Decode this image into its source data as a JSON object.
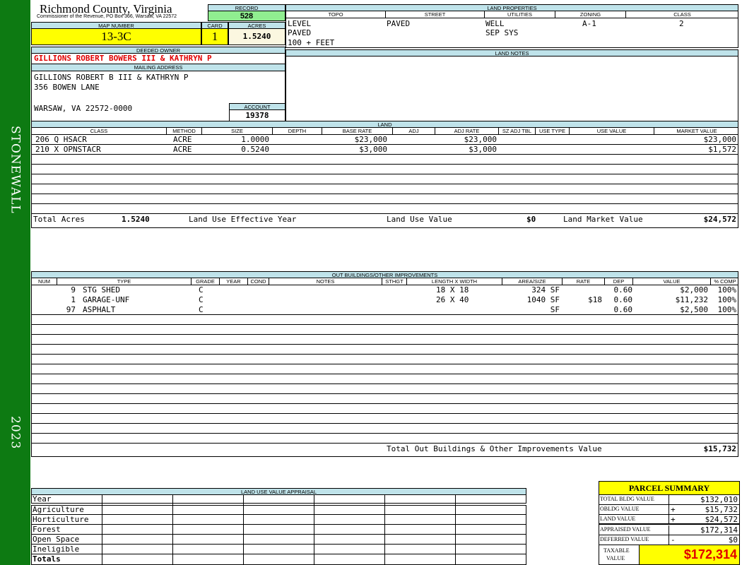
{
  "sidebar": {
    "district": "STONEWALL",
    "year": "2023"
  },
  "header": {
    "county": "Richmond County, Virginia",
    "address": "Commissioner of the Revenue, PO Box 366, Warsaw, VA 22572",
    "record_label": "RECORD",
    "record": "528",
    "map_number_label": "MAP NUMBER",
    "map_number": "13-3C",
    "card_label": "CARD",
    "card": "1",
    "acres_label": "ACRES",
    "acres": "1.5240"
  },
  "owner": {
    "deeded_owner_label": "DEEDED OWNER",
    "deeded_owner": "GILLIONS ROBERT BOWERS III & KATHRYN P",
    "mailing_label": "MAILING ADDRESS",
    "mailing_line1": "GILLIONS ROBERT B III & KATHRYN P",
    "mailing_line2": "356 BOWEN LANE",
    "mailing_line3": "WARSAW, VA 22572-0000",
    "account_label": "ACCOUNT",
    "account": "19378"
  },
  "land_properties": {
    "title": "LAND PROPERTIES",
    "headers": [
      "TOPO",
      "STREET",
      "UTILITIES",
      "ZONING",
      "CLASS"
    ],
    "topo": [
      "LEVEL",
      "PAVED",
      "100 + FEET"
    ],
    "street": [
      "PAVED"
    ],
    "utilities": [
      "WELL",
      "SEP SYS"
    ],
    "zoning": "A-1",
    "class": "2"
  },
  "land_notes": {
    "title": "LAND NOTES"
  },
  "land": {
    "title": "LAND",
    "headers": [
      "CLASS",
      "METHOD",
      "SIZE",
      "DEPTH",
      "BASE RATE",
      "ADJ",
      "ADJ RATE",
      "SZ ADJ TBL",
      "USE TYPE",
      "USE VALUE",
      "MARKET VALUE"
    ],
    "rows": [
      {
        "class": "206 Q HSACR",
        "method": "ACRE",
        "size": "1.0000",
        "base_rate": "$23,000",
        "adj_rate": "$23,000",
        "market_value": "$23,000"
      },
      {
        "class": "210 X OPNSTACR",
        "method": "ACRE",
        "size": "0.5240",
        "base_rate": "$3,000",
        "adj_rate": "$3,000",
        "market_value": "$1,572"
      }
    ],
    "total_acres_label": "Total Acres",
    "total_acres": "1.5240",
    "effective_year_label": "Land Use Effective Year",
    "use_value_label": "Land Use Value",
    "use_value": "$0",
    "market_value_label": "Land Market Value",
    "market_value": "$24,572"
  },
  "outbuildings": {
    "title": "OUT BUILDINGS/OTHER IMPROVEMENTS",
    "headers": [
      "NUM",
      "TYPE",
      "GRADE",
      "YEAR",
      "COND",
      "NOTES",
      "STHGT",
      "LENGTH X WIDTH",
      "AREA/SIZE",
      "RATE",
      "DEP",
      "VALUE",
      "% COMP"
    ],
    "rows": [
      {
        "num": "9",
        "type": "STG SHED",
        "grade": "C",
        "lxw": "18 X 18",
        "area": "324 SF",
        "rate": "",
        "dep": "0.60",
        "value": "$2,000",
        "comp": "100%"
      },
      {
        "num": "1",
        "type": "GARAGE-UNF",
        "grade": "C",
        "lxw": "26 X 40",
        "area": "1040 SF",
        "rate": "$18",
        "dep": "0.60",
        "value": "$11,232",
        "comp": "100%"
      },
      {
        "num": "97",
        "type": "ASPHALT",
        "grade": "C",
        "lxw": "",
        "area": "SF",
        "rate": "",
        "dep": "0.60",
        "value": "$2,500",
        "comp": "100%"
      }
    ],
    "total_label": "Total Out Buildings & Other Improvements Value",
    "total": "$15,732"
  },
  "land_use": {
    "title": "LAND USE VALUE APPRAISAL",
    "rows": [
      "Year",
      "Agriculture",
      "Horticulture",
      "Forest",
      "Open Space",
      "Ineligible",
      "Totals"
    ]
  },
  "summary": {
    "title": "PARCEL SUMMARY",
    "total_bldg_label": "TOTAL BLDG VALUE",
    "total_bldg": "$132,010",
    "obldg_label": "OBLDG VALUE",
    "obldg_sign": "+",
    "obldg": "$15,732",
    "land_label": "LAND VALUE",
    "land_sign": "+",
    "land": "$24,572",
    "appraised_label": "APPRAISED VALUE",
    "appraised": "$172,314",
    "deferred_label": "DEFERRED VALUE",
    "deferred_sign": "-",
    "deferred": "$0",
    "taxable_label1": "TAXABLE",
    "taxable_label2": "VALUE",
    "taxable": "$172,314"
  }
}
